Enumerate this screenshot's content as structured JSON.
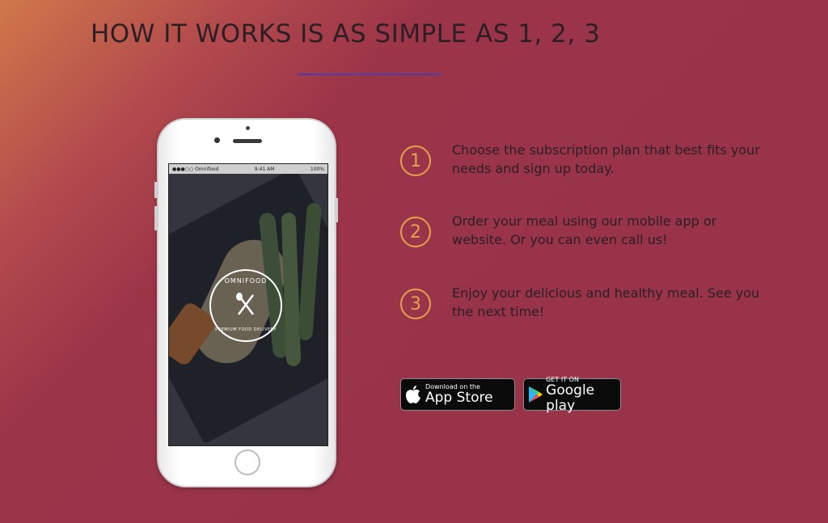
{
  "section": {
    "title": "HOW IT WORKS IS AS SIMPLE AS 1, 2, 3"
  },
  "phone": {
    "status_carrier": "●●●○○ Omnifood",
    "status_time": "9:41 AM",
    "status_battery": "100%",
    "logo_top": "OMNIFOOD",
    "logo_bottom": "PREMIUM FOOD DELIVERY"
  },
  "steps": [
    {
      "number": "1",
      "text": "Choose the subscription plan that best fits your needs and sign up today."
    },
    {
      "number": "2",
      "text": "Order your meal using our mobile app or website. Or you can even call us!"
    },
    {
      "number": "3",
      "text": "Enjoy your delicious and healthy meal. See you the next time!"
    }
  ],
  "stores": {
    "apple_small": "Download on the",
    "apple_big": "App Store",
    "google_small": "GET IT ON",
    "google_big": "Google play"
  },
  "colors": {
    "accent": "#e8a14b",
    "rule": "#4a3fa6",
    "background": "#98334a"
  },
  "icons": [
    "apple-icon",
    "google-play-icon",
    "cutlery-icon",
    "wifi-icon"
  ]
}
